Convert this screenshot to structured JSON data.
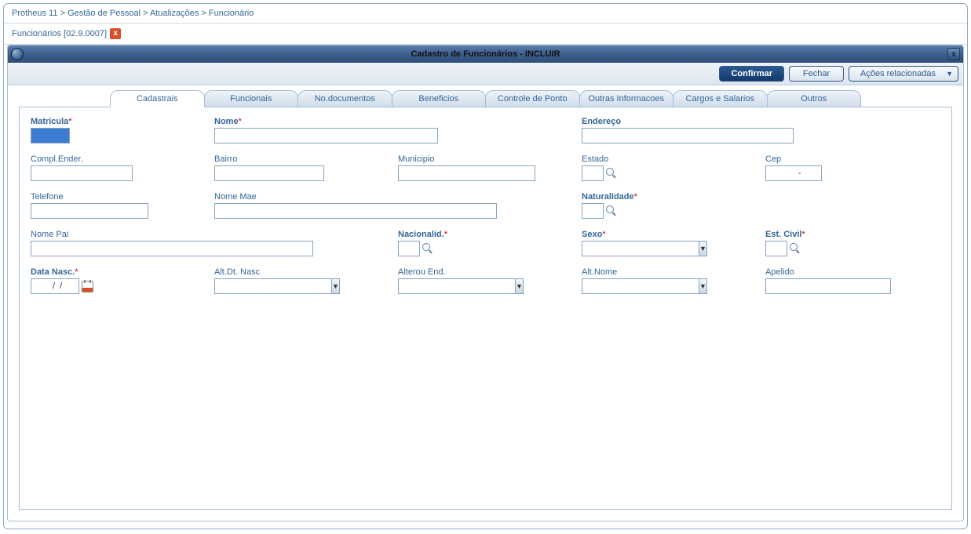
{
  "breadcrumb": [
    "Protheus 11",
    "Gestão de Pessoal",
    "Atualizações",
    "Funcionário"
  ],
  "tab_title": "Funcionários [02.9.0007]",
  "window_title": "Cadastro de Funcionários - INCLUIR",
  "buttons": {
    "confirm": "Confirmar",
    "close": "Fechar",
    "related": "Ações relacionadas"
  },
  "tabs": [
    "Cadastrais",
    "Funcionais",
    "No.documentos",
    "Beneficios",
    "Controle de Ponto",
    "Outras Informacoes",
    "Cargos e Salarios",
    "Outros"
  ],
  "active_tab": 0,
  "fields": {
    "matricula": {
      "label": "Matricula",
      "required": true,
      "bold": true,
      "value": ""
    },
    "nome": {
      "label": "Nome",
      "required": true,
      "bold": true,
      "value": ""
    },
    "endereco": {
      "label": "Endereço",
      "required": false,
      "bold": true,
      "value": ""
    },
    "compl_ender": {
      "label": "Compl.Ender.",
      "value": ""
    },
    "bairro": {
      "label": "Bairro",
      "value": ""
    },
    "municipio": {
      "label": "Municipio",
      "value": ""
    },
    "estado": {
      "label": "Estado",
      "value": ""
    },
    "cep": {
      "label": "Cep",
      "value": "     -"
    },
    "telefone": {
      "label": "Telefone",
      "value": ""
    },
    "nome_mae": {
      "label": "Nome Mae",
      "value": ""
    },
    "naturalidade": {
      "label": "Naturalidade",
      "required": true,
      "bold": true,
      "value": ""
    },
    "nome_pai": {
      "label": "Nome Pai",
      "value": ""
    },
    "nacionalid": {
      "label": "Nacionalid.",
      "required": true,
      "bold": true,
      "value": ""
    },
    "sexo": {
      "label": "Sexo",
      "required": true,
      "bold": true,
      "value": ""
    },
    "est_civil": {
      "label": "Est. Civil",
      "required": true,
      "bold": true,
      "value": ""
    },
    "data_nasc": {
      "label": "Data Nasc.",
      "required": true,
      "bold": true,
      "value": "  /  /"
    },
    "alt_dt_nasc": {
      "label": "Alt.Dt. Nasc",
      "value": ""
    },
    "alterou_end": {
      "label": "Alterou End.",
      "value": ""
    },
    "alt_nome": {
      "label": "Alt.Nome",
      "value": ""
    },
    "apelido": {
      "label": "Apelido",
      "value": ""
    }
  }
}
